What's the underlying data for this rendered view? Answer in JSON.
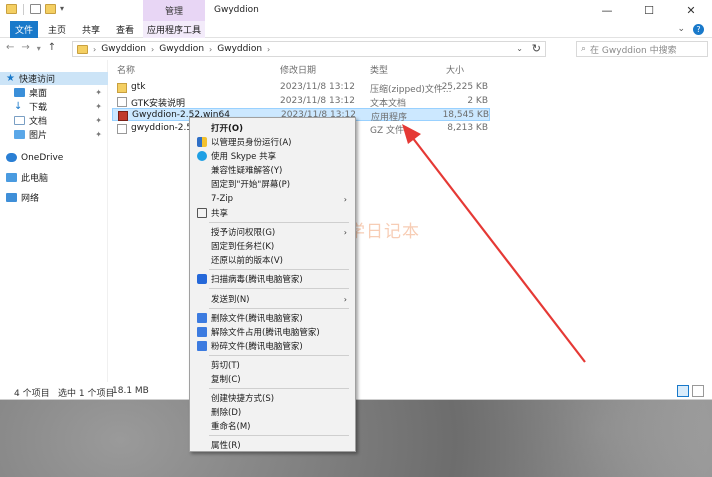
{
  "window": {
    "title": "Gwyddion",
    "context_tab_label": "管理",
    "controls": [
      "—",
      "☐",
      "✕"
    ]
  },
  "ribbon": {
    "tabs": [
      "文件",
      "主页",
      "共享",
      "查看",
      "应用程序工具"
    ],
    "expand": "⌄"
  },
  "address": {
    "path": [
      "Gwyddion",
      "Gwyddion",
      "Gwyddion"
    ],
    "search_placeholder": "在 Gwyddion 中搜索"
  },
  "nav_pane": {
    "items": [
      {
        "label": "快速访问",
        "icon": "star-icon"
      },
      {
        "label": "桌面",
        "icon": "desktop-icon"
      },
      {
        "label": "下载",
        "icon": "download-icon"
      },
      {
        "label": "文档",
        "icon": "document-icon"
      },
      {
        "label": "图片",
        "icon": "picture-icon"
      },
      {
        "label": "OneDrive",
        "icon": "cloud-icon"
      },
      {
        "label": "此电脑",
        "icon": "pc-icon"
      },
      {
        "label": "网络",
        "icon": "network-icon"
      }
    ]
  },
  "columns": {
    "name": "名称",
    "date": "修改日期",
    "type": "类型",
    "size": "大小"
  },
  "files": [
    {
      "name": "gtk",
      "date": "2023/11/8 13:12",
      "type": "压缩(zipped)文件...",
      "size": "25,225 KB"
    },
    {
      "name": "GTK安装说明",
      "date": "2023/11/8 13:12",
      "type": "文本文档",
      "size": "2 KB"
    },
    {
      "name": "Gwyddion-2.52.win64",
      "date": "2023/11/8 13:12",
      "type": "应用程序",
      "size": "18,545 KB"
    },
    {
      "name": "gwyddion-2.56.t",
      "date": "",
      "type": "GZ 文件",
      "size": "8,213 KB"
    }
  ],
  "status": {
    "count": "4 个项目",
    "selected": "选中 1 个项目",
    "size": "18.1 MB"
  },
  "context_menu": {
    "open": "打开(O)",
    "run_as_admin": "以管理员身份运行(A)",
    "skype_share": "使用 Skype 共享",
    "compat": "兼容性疑难解答(Y)",
    "pin_start": "固定到\"开始\"屏幕(P)",
    "zip": "7-Zip",
    "share": "共享",
    "grant_access": "授予访问权限(G)",
    "pin_taskbar": "固定到任务栏(K)",
    "restore": "还原以前的版本(V)",
    "scan_virus": "扫描病毒(腾讯电脑管家)",
    "send_to": "发送到(N)",
    "delete_file": "删除文件(腾讯电脑管家)",
    "unlock_file": "解除文件占用(腾讯电脑管家)",
    "shred_file": "粉碎文件(腾讯电脑管家)",
    "cut": "剪切(T)",
    "copy": "复制(C)",
    "create_shortcut": "创建快捷方式(S)",
    "delete": "删除(D)",
    "rename": "重命名(M)",
    "properties": "属性(R)"
  },
  "watermark": "丁俊学日记本",
  "colors": {
    "accent": "#1979ca",
    "selection": "#cce8ff",
    "arrow": "#e53935"
  }
}
